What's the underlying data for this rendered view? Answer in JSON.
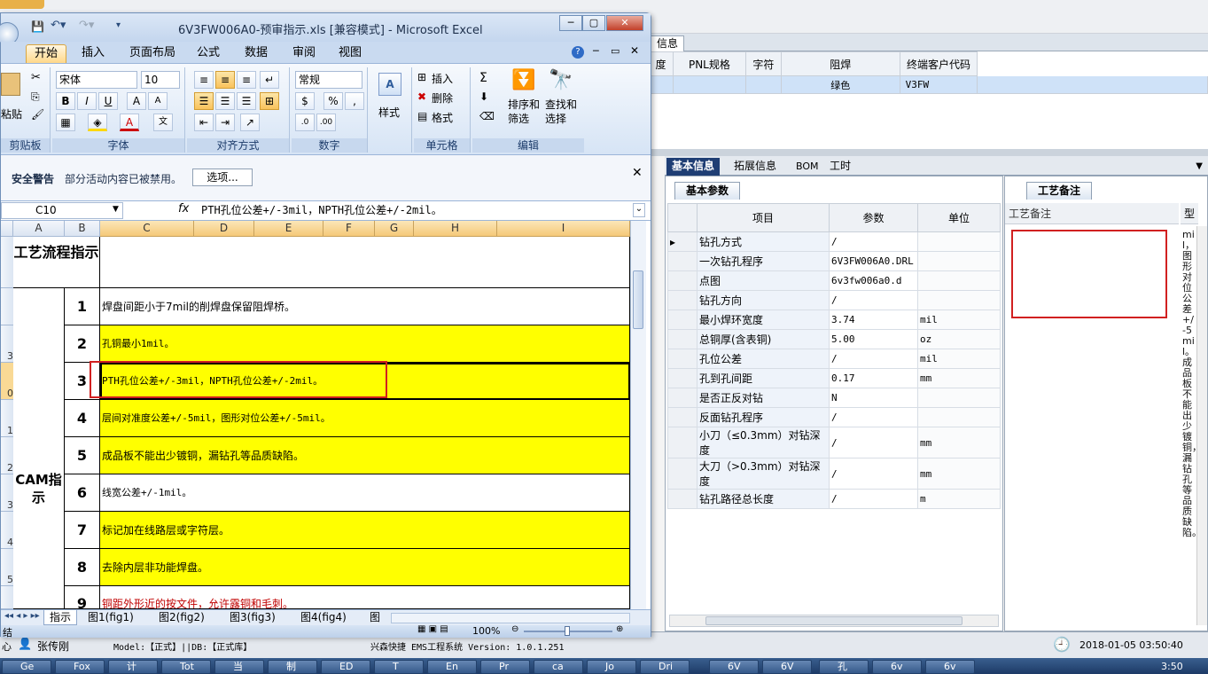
{
  "upper": {
    "tab_label": "信息",
    "columns": [
      "度",
      "PNL规格",
      "字符",
      "阻焊",
      "终端客户代码"
    ],
    "row": {
      "solder": "绿色",
      "customer_code": "V3FW"
    }
  },
  "main_tabs": [
    "基本信息",
    "拓展信息",
    "BOM",
    "工时"
  ],
  "params": {
    "tab": "基本参数",
    "headers": [
      "项目",
      "参数",
      "单位"
    ],
    "rows": [
      {
        "name": "钻孔方式",
        "value": "/",
        "unit": ""
      },
      {
        "name": "一次钻孔程序",
        "value": "6V3FW006A0.DRL",
        "unit": ""
      },
      {
        "name": "点图",
        "value": "6v3fw006a0.d",
        "unit": ""
      },
      {
        "name": "钻孔方向",
        "value": "/",
        "unit": ""
      },
      {
        "name": "最小焊环宽度",
        "value": "3.74",
        "unit": "mil"
      },
      {
        "name": "总铜厚(含表铜)",
        "value": "5.00",
        "unit": "oz"
      },
      {
        "name": "孔位公差",
        "value": "/",
        "unit": "mil"
      },
      {
        "name": "孔到孔间距",
        "value": "0.17",
        "unit": "mm"
      },
      {
        "name": "是否正反对钻",
        "value": "N",
        "unit": ""
      },
      {
        "name": "反面钻孔程序",
        "value": "/",
        "unit": ""
      },
      {
        "name": "小刀（≤0.3mm）对钻深度",
        "value": "/",
        "unit": "mm"
      },
      {
        "name": "大刀（>0.3mm）对钻深度",
        "value": "/",
        "unit": "mm"
      },
      {
        "name": "钻孔路径总长度",
        "value": "/",
        "unit": "m"
      }
    ]
  },
  "notes": {
    "tab": "工艺备注",
    "header": "工艺备注",
    "side_header": "型",
    "side_text": "mil，图形对位公差+/-5mil。成品板不能出少镀铜，漏钻孔等品质缺陷。"
  },
  "status": {
    "user": "张传刚",
    "model": "Model:【正式】||DB:【正式库】",
    "system": "兴森快捷 EMS工程系统 Version: 1.0.1.251",
    "datetime": "2018-01-05 03:50:40",
    "left_char": "心"
  },
  "taskbar": {
    "items": [
      "Ge",
      "Fox",
      "计",
      "Tot",
      "当",
      "制",
      "ED",
      "T",
      "En",
      "Pr",
      "ca",
      "Jo",
      "Dri",
      "6V",
      "6V",
      "孔",
      "6v",
      "6v"
    ],
    "clock": "3:50"
  },
  "excel": {
    "title": "6V3FW006A0-预审指示.xls  [兼容模式] - Microsoft Excel",
    "ribbon_tabs": [
      "开始",
      "插入",
      "页面布局",
      "公式",
      "数据",
      "审阅",
      "视图"
    ],
    "font_name": "宋体",
    "font_size": "10",
    "number_format": "常规",
    "groups": [
      "剪贴板",
      "字体",
      "对齐方式",
      "数字",
      "单元格",
      "编辑"
    ],
    "paste": "粘贴",
    "style": "样式",
    "cells_actions": [
      "插入",
      "删除",
      "格式"
    ],
    "sort": "排序和筛选",
    "find": "查找和选择",
    "security_label": "安全警告",
    "security_msg": "部分活动内容已被禁用。",
    "options_btn": "选项...",
    "name_box": "C10",
    "formula": "PTH孔位公差+/-3mil，NPTH孔位公差+/-2mil。",
    "columns": [
      "A",
      "B",
      "C",
      "D",
      "E",
      "F",
      "G",
      "H",
      "I"
    ],
    "row_header_labels": [
      "",
      "",
      "3",
      "9",
      "0",
      "1",
      "2",
      "3",
      "4",
      "5"
    ],
    "header_cell": "工艺流程指示",
    "section": "CAM指示",
    "rows": [
      {
        "n": "1",
        "text": "焊盘间距小于7mil的削焊盘保留阻焊桥。",
        "yellow": false
      },
      {
        "n": "2",
        "text": "孔铜最小1mil。",
        "yellow": true
      },
      {
        "n": "3",
        "text": "PTH孔位公差+/-3mil，NPTH孔位公差+/-2mil。",
        "yellow": true
      },
      {
        "n": "4",
        "text": "层间对准度公差+/-5mil，图形对位公差+/-5mil。",
        "yellow": true
      },
      {
        "n": "5",
        "text": "成品板不能出少镀铜，漏钻孔等品质缺陷。",
        "yellow": true
      },
      {
        "n": "6",
        "text": "线宽公差+/-1mil。",
        "yellow": false
      },
      {
        "n": "7",
        "text": "标记加在线路层或字符层。",
        "yellow": true
      },
      {
        "n": "8",
        "text": "去除内层非功能焊盘。",
        "yellow": true
      },
      {
        "n": "9",
        "text": "铜距外形近的按文件，允许露铜和毛刺。",
        "yellow": false
      }
    ],
    "sheet_tabs": [
      "指示",
      "图1(fig1)",
      "图2(fig2)",
      "图3(fig3)",
      "图4(fig4)",
      "图"
    ],
    "status_left": "结",
    "zoom": "100%"
  }
}
